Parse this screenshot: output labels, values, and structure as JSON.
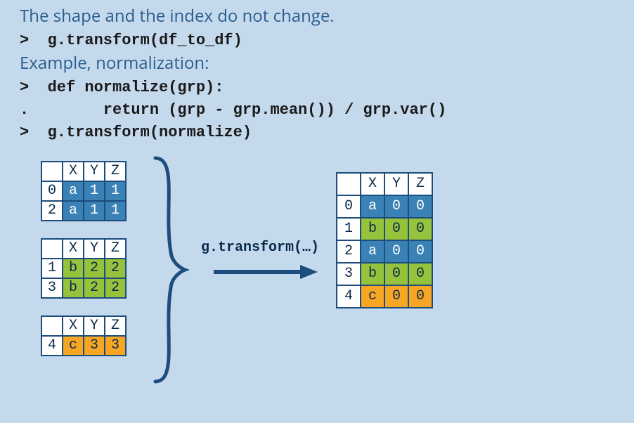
{
  "text": {
    "line1": "The shape and the index do not change.",
    "code1_prompt": ">",
    "code1": "g.transform(df_to_df)",
    "line2": "Example, normalization:",
    "code2a_prompt": ">",
    "code2a": "def normalize(grp):",
    "code2b_prompt": ".",
    "code2b": "      return (grp - grp.mean()) / grp.var()",
    "code2c_prompt": ">",
    "code2c": "g.transform(normalize)",
    "transform_label": "g.transform(…)"
  },
  "groups": [
    {
      "color": "blue",
      "columns": [
        "X",
        "Y",
        "Z"
      ],
      "rows": [
        {
          "idx": "0",
          "vals": [
            "a",
            "1",
            "1"
          ]
        },
        {
          "idx": "2",
          "vals": [
            "a",
            "1",
            "1"
          ]
        }
      ]
    },
    {
      "color": "green",
      "columns": [
        "X",
        "Y",
        "Z"
      ],
      "rows": [
        {
          "idx": "1",
          "vals": [
            "b",
            "2",
            "2"
          ]
        },
        {
          "idx": "3",
          "vals": [
            "b",
            "2",
            "2"
          ]
        }
      ]
    },
    {
      "color": "orange",
      "columns": [
        "X",
        "Y",
        "Z"
      ],
      "rows": [
        {
          "idx": "4",
          "vals": [
            "c",
            "3",
            "3"
          ]
        }
      ]
    }
  ],
  "result": {
    "columns": [
      "X",
      "Y",
      "Z"
    ],
    "rows": [
      {
        "idx": "0",
        "vals": [
          "a",
          "0",
          "0"
        ],
        "color": "blue"
      },
      {
        "idx": "1",
        "vals": [
          "b",
          "0",
          "0"
        ],
        "color": "green"
      },
      {
        "idx": "2",
        "vals": [
          "a",
          "0",
          "0"
        ],
        "color": "blue"
      },
      {
        "idx": "3",
        "vals": [
          "b",
          "0",
          "0"
        ],
        "color": "green"
      },
      {
        "idx": "4",
        "vals": [
          "c",
          "0",
          "0"
        ],
        "color": "orange"
      }
    ]
  }
}
